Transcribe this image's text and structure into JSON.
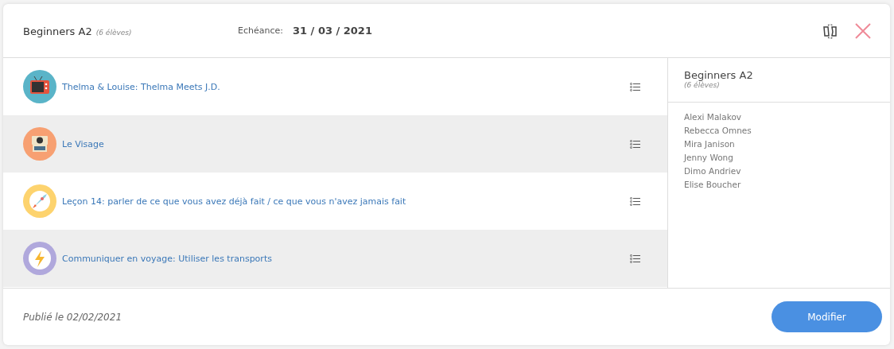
{
  "header": {
    "group": "Beginners A2",
    "count": "(6 élèves)",
    "due_label": "Echéance:",
    "due_date": "31 / 03 / 2021"
  },
  "lessons": [
    {
      "title": "Thelma & Louise: Thelma Meets J.D.",
      "kind": "tv",
      "color": "#5ab4c8"
    },
    {
      "title": "Le Visage",
      "kind": "camera",
      "color": "#f7a072"
    },
    {
      "title": "Leçon 14: parler de ce que vous avez déjà fait / ce que vous n'avez jamais fait",
      "kind": "rocket",
      "color": "#fdd36e"
    },
    {
      "title": "Communiquer en voyage: Utiliser les transports",
      "kind": "bolt",
      "color": "#b0a8dc"
    }
  ],
  "panel": {
    "group": "Beginners A2",
    "count": "(6 élèves)",
    "students": [
      "Alexi Malakov",
      "Rebecca Omnes",
      "Mira Janison",
      "Jenny Wong",
      "Dimo Andriev",
      "Elise Boucher"
    ]
  },
  "footer": {
    "published": "Publié le 02/02/2021",
    "button": "Modifier"
  }
}
